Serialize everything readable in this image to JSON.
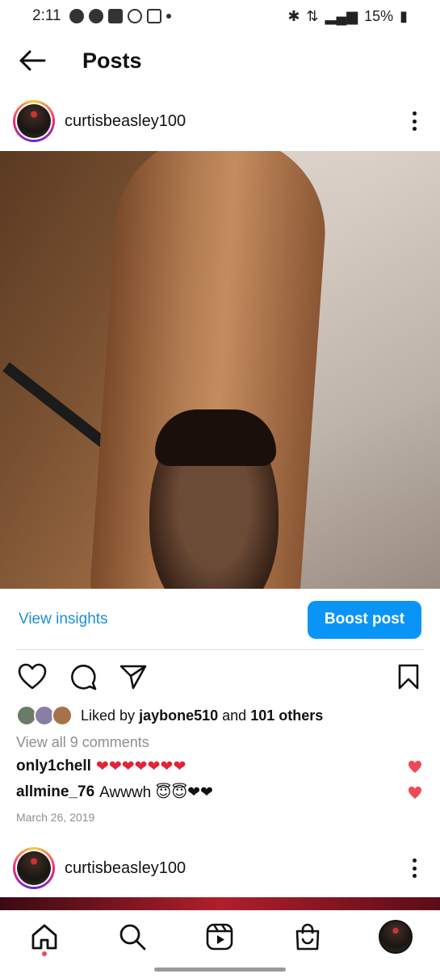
{
  "status_bar": {
    "time": "2:11",
    "battery": "15%"
  },
  "header": {
    "title": "Posts"
  },
  "post": {
    "username": "curtisbeasley100",
    "view_insights": "View insights",
    "boost_post": "Boost post",
    "liked_by_prefix": "Liked by",
    "liked_by_user": "jaybone510",
    "liked_by_and": "and",
    "liked_by_others": "101 others",
    "view_comments": "View all 9 comments",
    "comments": [
      {
        "user": "only1chell",
        "text": "❤❤❤❤❤❤❤"
      },
      {
        "user": "allmine_76",
        "text": "Awwwh 😇😇❤❤"
      }
    ],
    "date": "March 26, 2019"
  },
  "next_post": {
    "username": "curtisbeasley100"
  },
  "colors": {
    "accent": "#0a95f6",
    "link": "#1c8fd6",
    "like_red": "#ed4956"
  }
}
